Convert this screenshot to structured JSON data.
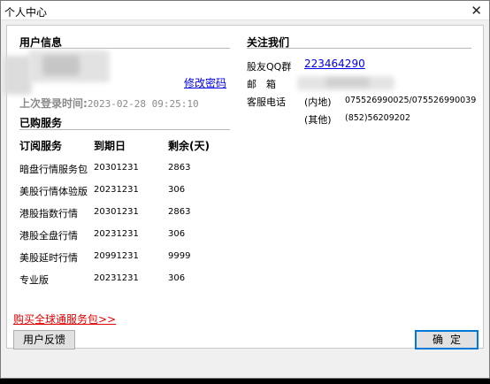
{
  "window": {
    "title": "个人中心",
    "close_glyph": "✕"
  },
  "user_info": {
    "section_title": "用户信息",
    "change_password": "修改密码",
    "last_login_label": "上次登录时间:",
    "last_login_value": "2023-02-28 09:25:10"
  },
  "purchased": {
    "section_title": "已购服务",
    "headers": [
      "订阅服务",
      "到期日",
      "剩余(天)"
    ],
    "rows": [
      [
        "暗盘行情服务包",
        "20301231",
        "2863"
      ],
      [
        "美股行情体验版",
        "20231231",
        "306"
      ],
      [
        "港股指数行情",
        "20301231",
        "2863"
      ],
      [
        "港股全盘行情",
        "20231231",
        "306"
      ],
      [
        "美股延时行情",
        "20991231",
        "9999"
      ],
      [
        "专业版",
        "20231231",
        "306"
      ]
    ]
  },
  "follow_us": {
    "section_title": "关注我们",
    "qq_label": "股友QQ群",
    "qq_value": "223464290",
    "email_label": "邮　箱",
    "phone_label": "客服电话",
    "phone_mainland_label": "(内地)",
    "phone_mainland_value": "075526990025/075526990039",
    "phone_other_label": "(其他)",
    "phone_other_value": "(852)56209202"
  },
  "footer": {
    "buy_link": "购买全球通服务包>>",
    "feedback_button": "用户反馈",
    "ok_button": "确定"
  },
  "colors": {
    "link": "#0000ee",
    "buy_link": "#e00000",
    "ok_border": "#0078d7"
  }
}
